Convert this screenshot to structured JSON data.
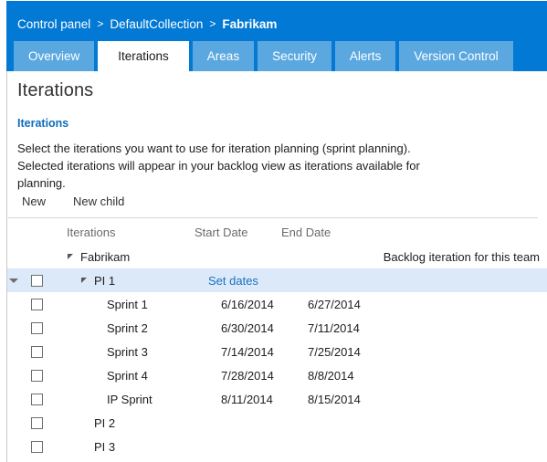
{
  "header": {
    "breadcrumb": {
      "items": [
        "Control panel",
        "DefaultCollection",
        "Fabrikam"
      ],
      "separator": ">"
    },
    "tabs": [
      {
        "label": "Overview",
        "active": false
      },
      {
        "label": "Iterations",
        "active": true
      },
      {
        "label": "Areas",
        "active": false
      },
      {
        "label": "Security",
        "active": false
      },
      {
        "label": "Alerts",
        "active": false
      },
      {
        "label": "Version Control",
        "active": false
      }
    ]
  },
  "page": {
    "title": "Iterations",
    "section_title": "Iterations",
    "description": "Select the iterations you want to use for iteration planning (sprint planning). Selected iterations will appear in your backlog view as iterations available for planning."
  },
  "toolbar": {
    "new_label": "New",
    "new_child_label": "New child"
  },
  "grid": {
    "columns": {
      "iterations": "Iterations",
      "start_date": "Start Date",
      "end_date": "End Date"
    },
    "rows": [
      {
        "name": "Fabrikam",
        "indent": 0,
        "expanded": true,
        "checkbox": false,
        "start": "",
        "end": "",
        "note": "Backlog iteration for this team",
        "selected": false,
        "gutter_caret": false,
        "set_dates": ""
      },
      {
        "name": "PI 1",
        "indent": 1,
        "expanded": true,
        "checkbox": true,
        "start": "",
        "end": "",
        "note": "",
        "selected": true,
        "gutter_caret": true,
        "set_dates": "Set dates"
      },
      {
        "name": "Sprint 1",
        "indent": 2,
        "expanded": false,
        "checkbox": true,
        "start": "6/16/2014",
        "end": "6/27/2014",
        "note": "",
        "selected": false,
        "gutter_caret": false,
        "set_dates": ""
      },
      {
        "name": "Sprint 2",
        "indent": 2,
        "expanded": false,
        "checkbox": true,
        "start": "6/30/2014",
        "end": "7/11/2014",
        "note": "",
        "selected": false,
        "gutter_caret": false,
        "set_dates": ""
      },
      {
        "name": "Sprint 3",
        "indent": 2,
        "expanded": false,
        "checkbox": true,
        "start": "7/14/2014",
        "end": "7/25/2014",
        "note": "",
        "selected": false,
        "gutter_caret": false,
        "set_dates": ""
      },
      {
        "name": "Sprint 4",
        "indent": 2,
        "expanded": false,
        "checkbox": true,
        "start": "7/28/2014",
        "end": "8/8/2014",
        "note": "",
        "selected": false,
        "gutter_caret": false,
        "set_dates": ""
      },
      {
        "name": "IP Sprint",
        "indent": 2,
        "expanded": false,
        "checkbox": true,
        "start": "8/11/2014",
        "end": "8/15/2014",
        "note": "",
        "selected": false,
        "gutter_caret": false,
        "set_dates": ""
      },
      {
        "name": "PI 2",
        "indent": 1,
        "expanded": false,
        "checkbox": true,
        "start": "",
        "end": "",
        "note": "",
        "selected": false,
        "gutter_caret": false,
        "set_dates": ""
      },
      {
        "name": "PI 3",
        "indent": 1,
        "expanded": false,
        "checkbox": true,
        "start": "",
        "end": "",
        "note": "",
        "selected": false,
        "gutter_caret": false,
        "set_dates": ""
      }
    ]
  },
  "colors": {
    "header_blue": "#0279d4",
    "tab_blue": "#5ba8e0",
    "link_blue": "#1a71c4",
    "section_blue": "#0f6cbd",
    "row_selected": "#dce9f8"
  }
}
